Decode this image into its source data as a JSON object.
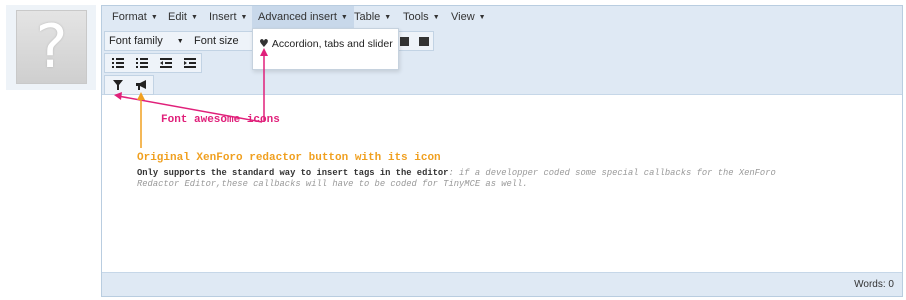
{
  "menubar": {
    "items": [
      {
        "label": "Format"
      },
      {
        "label": "Edit"
      },
      {
        "label": "Insert"
      },
      {
        "label": "Advanced insert"
      },
      {
        "label": "Table"
      },
      {
        "label": "Tools"
      },
      {
        "label": "View"
      }
    ]
  },
  "toolbar": {
    "font_family": "Font family",
    "font_size": "Font size",
    "list_buttons": [
      "bullet-list-icon",
      "numbered-list-icon",
      "outdent-icon",
      "indent-icon"
    ],
    "xenforo_buttons": [
      "filter-icon",
      "bullhorn-icon"
    ]
  },
  "dropdown": {
    "item_label": "Accordion, tabs and slider",
    "item_icon": "heart-icon"
  },
  "annotations": {
    "font_awesome": "Font awesome icons",
    "original_xenforo": "Original XenForo redactor button with its icon",
    "desc_bold": "Only supports the standard way to insert tags in the editor",
    "desc_italic": ": if a developper coded some special callbacks for the XenForo Redactor Editor,these callbacks will have to be coded for TinyMCE as well."
  },
  "statusbar": {
    "words": "Words: 0"
  },
  "colors": {
    "toolbar_bg": "#dfe9f4",
    "pink_annotation": "#e0207a",
    "orange_annotation": "#f0a020"
  }
}
